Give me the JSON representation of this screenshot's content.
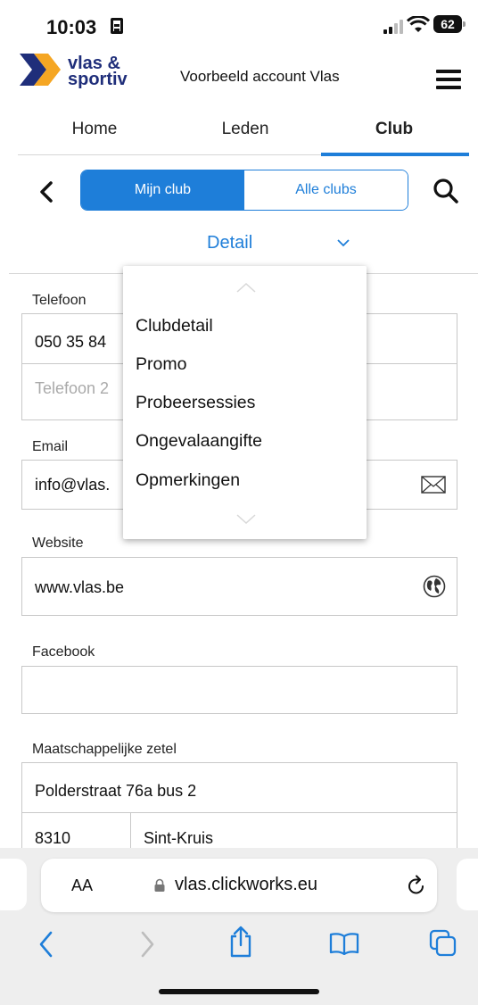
{
  "status_bar": {
    "time": "10:03",
    "battery": "62"
  },
  "header": {
    "account": "Voorbeeld account Vlas",
    "logo_line1": "vlas &",
    "logo_line2": "sportiv"
  },
  "tabs": [
    {
      "label": "Home"
    },
    {
      "label": "Leden"
    },
    {
      "label": "Club",
      "active": true
    }
  ],
  "segment": {
    "left": "Mijn club",
    "right": "Alle clubs",
    "selected": "Mijn club"
  },
  "detail": {
    "label": "Detail"
  },
  "form": {
    "telefoon_label": "Telefoon",
    "telefoon_value": "050 35 84",
    "telefoon2_placeholder": "Telefoon 2",
    "email_label": "Email",
    "email_value": "info@vlas.",
    "website_label": "Website",
    "website_value": "www.vlas.be",
    "facebook_label": "Facebook",
    "facebook_value": "",
    "zetel_label": "Maatschappelijke zetel",
    "street": "Polderstraat 76a bus 2",
    "postcode": "8310",
    "city": "Sint-Kruis"
  },
  "dropdown": {
    "items": [
      "Clubdetail",
      "Promo",
      "Probeersessies",
      "Ongevalaangifte",
      "Opmerkingen"
    ]
  },
  "browser": {
    "aa": "AA",
    "url": "vlas.clickworks.eu"
  },
  "colors": {
    "accent": "#1e7ed9",
    "brand_blue": "#1f2e7a",
    "brand_orange": "#f5a623"
  }
}
